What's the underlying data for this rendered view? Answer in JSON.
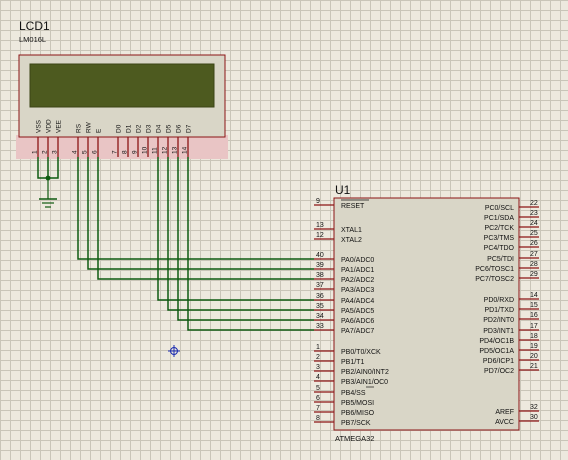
{
  "colors": {
    "background": "#ede9de",
    "grid": "#c9c5b8",
    "wire": "#0f5a10",
    "pin": "#8c1414",
    "body_border": "#8c1414",
    "body_fill": "#d9d6c7",
    "lcd_halo": "#e9c5c5",
    "lcd_screen": "#4d5a1f",
    "text": "#111111",
    "cursor": "#1a2bb0"
  },
  "lcd": {
    "ref": "LCD1",
    "model": "LM016L",
    "pins": [
      {
        "name": "VSS",
        "num": "1"
      },
      {
        "name": "VDD",
        "num": "2"
      },
      {
        "name": "VEE",
        "num": "3"
      },
      {
        "name": "RS",
        "num": "4"
      },
      {
        "name": "RW",
        "num": "5"
      },
      {
        "name": "E",
        "num": "6"
      },
      {
        "name": "D0",
        "num": "7"
      },
      {
        "name": "D1",
        "num": "8"
      },
      {
        "name": "D2",
        "num": "9"
      },
      {
        "name": "D3",
        "num": "10"
      },
      {
        "name": "D4",
        "num": "11"
      },
      {
        "name": "D5",
        "num": "12"
      },
      {
        "name": "D6",
        "num": "13"
      },
      {
        "name": "D7",
        "num": "14"
      }
    ]
  },
  "mcu": {
    "ref": "U1",
    "part": "ATMEGA32",
    "left_pins": [
      {
        "num": "9",
        "name": "RESET",
        "overbar": true
      },
      {
        "num": "13",
        "name": "XTAL1"
      },
      {
        "num": "12",
        "name": "XTAL2"
      },
      {
        "num": "40",
        "name": "PA0/ADC0"
      },
      {
        "num": "39",
        "name": "PA1/ADC1"
      },
      {
        "num": "38",
        "name": "PA2/ADC2"
      },
      {
        "num": "37",
        "name": "PA3/ADC3"
      },
      {
        "num": "36",
        "name": "PA4/ADC4"
      },
      {
        "num": "35",
        "name": "PA5/ADC5"
      },
      {
        "num": "34",
        "name": "PA6/ADC6"
      },
      {
        "num": "33",
        "name": "PA7/ADC7"
      },
      {
        "num": "1",
        "name": "PB0/T0/XCK"
      },
      {
        "num": "2",
        "name": "PB1/T1"
      },
      {
        "num": "3",
        "name": "PB2/AIN0/INT2"
      },
      {
        "num": "4",
        "name": "PB3/AIN1/OC0"
      },
      {
        "num": "5",
        "name": "PB4/SS",
        "overbar": true
      },
      {
        "num": "6",
        "name": "PB5/MOSI"
      },
      {
        "num": "7",
        "name": "PB6/MISO"
      },
      {
        "num": "8",
        "name": "PB7/SCK"
      }
    ],
    "right_pins": [
      {
        "num": "22",
        "name": "PC0/SCL"
      },
      {
        "num": "23",
        "name": "PC1/SDA"
      },
      {
        "num": "24",
        "name": "PC2/TCK"
      },
      {
        "num": "25",
        "name": "PC3/TMS"
      },
      {
        "num": "26",
        "name": "PC4/TDO"
      },
      {
        "num": "27",
        "name": "PC5/TDI"
      },
      {
        "num": "28",
        "name": "PC6/TOSC1"
      },
      {
        "num": "29",
        "name": "PC7/TOSC2"
      },
      {
        "num": "14",
        "name": "PD0/RXD"
      },
      {
        "num": "15",
        "name": "PD1/TXD"
      },
      {
        "num": "16",
        "name": "PD2/INT0"
      },
      {
        "num": "17",
        "name": "PD3/INT1"
      },
      {
        "num": "18",
        "name": "PD4/OC1B"
      },
      {
        "num": "19",
        "name": "PD5/OC1A"
      },
      {
        "num": "20",
        "name": "PD6/ICP1"
      },
      {
        "num": "21",
        "name": "PD7/OC2"
      },
      {
        "num": "32",
        "name": "AREF"
      },
      {
        "num": "30",
        "name": "AVCC"
      }
    ]
  },
  "connections": [
    {
      "from": "LCD1.RS",
      "to": "U1.PA0/ADC0"
    },
    {
      "from": "LCD1.RW",
      "to": "U1.PA1/ADC1"
    },
    {
      "from": "LCD1.E",
      "to": "U1.PA2/ADC2"
    },
    {
      "from": "LCD1.D4",
      "to": "U1.PA4/ADC4"
    },
    {
      "from": "LCD1.D5",
      "to": "U1.PA5/ADC5"
    },
    {
      "from": "LCD1.D6",
      "to": "U1.PA6/ADC6"
    },
    {
      "from": "LCD1.D7",
      "to": "U1.PA7/ADC7"
    },
    {
      "from": "LCD1.VSS",
      "to": "GND"
    },
    {
      "from": "LCD1.VDD",
      "to": "GND"
    },
    {
      "from": "LCD1.VEE",
      "to": "GND"
    }
  ]
}
